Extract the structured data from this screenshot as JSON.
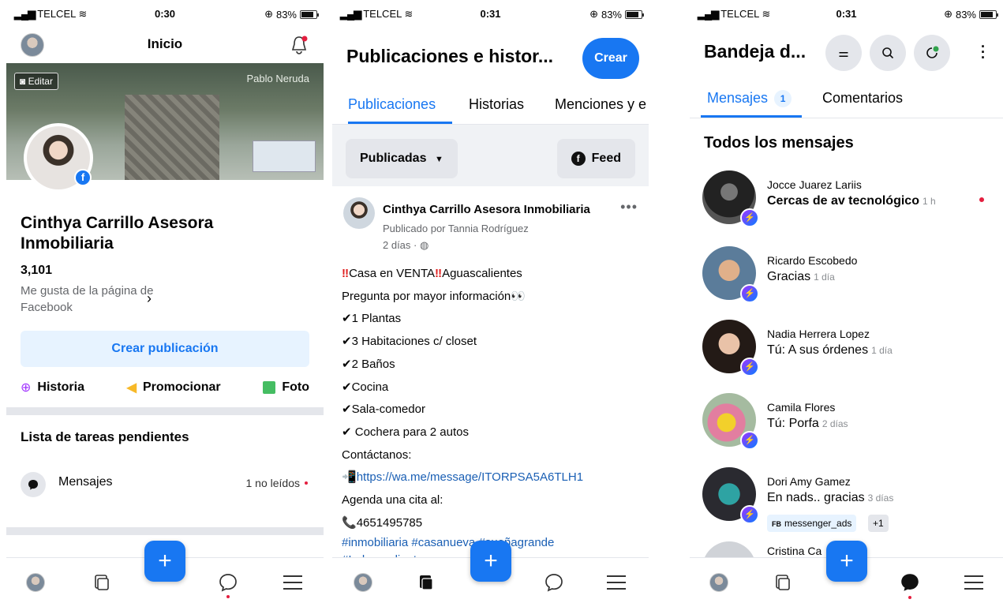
{
  "status": {
    "carrier": "TELCEL",
    "battery": "83%",
    "battery_level": 0.83,
    "time_1": "0:30",
    "time_2": "0:31",
    "time_3": "0:31"
  },
  "screen1": {
    "title": "Inicio",
    "cover_edit": "Editar",
    "cover_text": "Pablo Neruda",
    "page_name": "Cinthya Carrillo Asesora Inmobiliaria",
    "likes_count": "3,101",
    "likes_label": "Me gusta de la página de Facebook",
    "create_post": "Crear publicación",
    "actions": {
      "story": "Historia",
      "promote": "Promocionar",
      "photo": "Foto"
    },
    "todo_title": "Lista de tareas pendientes",
    "todo_messages": "Mensajes",
    "todo_unread": "1 no leídos"
  },
  "screen2": {
    "title": "Publicaciones e histor...",
    "create": "Crear",
    "tabs": [
      "Publicaciones",
      "Historias",
      "Menciones y e"
    ],
    "filter": "Publicadas",
    "feed": "Feed",
    "post": {
      "author": "Cinthya Carrillo Asesora Inmobiliaria",
      "published_by": "Publicado por Tannia Rodríguez",
      "time": "2 días · ",
      "line1": "Casa en VENTA",
      "line1b": "Aguascalientes",
      "line2": "Pregunta por mayor información",
      "line3": "1 Plantas",
      "line4": "3 Habitaciones c/ closet",
      "line5": "2 Baños",
      "line6": "Cocina",
      "line7": "Sala-comedor",
      "line8": " Cochera para 2 autos",
      "line9": "Contáctanos:",
      "link": "https://wa.me/message/ITORPSA5A6TLH1",
      "line11": "Agenda una cita al:",
      "phone": "4651495785",
      "hashtags1": "#inmobiliaria #casanueva  #sueñagrande",
      "hashtags2": "#Independiente"
    }
  },
  "screen3": {
    "title": "Bandeja d...",
    "tab_messages": "Mensajes",
    "tab_badge": "1",
    "tab_comments": "Comentarios",
    "section": "Todos los mensajes",
    "threads": [
      {
        "name": "Jocce Juarez Lariis",
        "preview": "Cercas de av tecnológico",
        "time": "1 h"
      },
      {
        "name": "Ricardo Escobedo",
        "preview": "Gracias",
        "time": "1 día"
      },
      {
        "name": "Nadia Herrera Lopez",
        "preview": "Tú: A sus órdenes",
        "time": "1 día"
      },
      {
        "name": "Camila Flores",
        "preview": "Tú: Porfa",
        "time": "2 días"
      },
      {
        "name": "Dori Amy Gamez",
        "preview": "En nads.. gracias",
        "time": "3 días"
      },
      {
        "name": "Cristina Ca"
      }
    ],
    "tag_fb": "FB",
    "tag_label": "messenger_ads",
    "tag_more": "+1"
  },
  "colors": {
    "accent": "#1877f2",
    "accent_light": "#e7f3ff",
    "gray": "#e4e6eb",
    "red": "#e41e3f"
  }
}
